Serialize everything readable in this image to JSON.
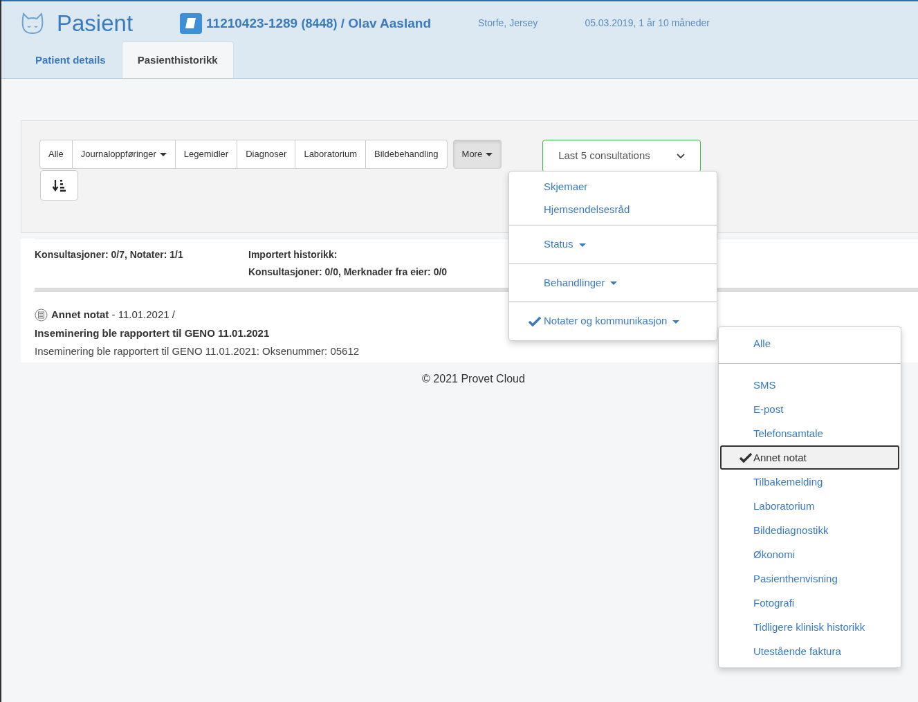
{
  "header": {
    "title": "Pasient",
    "record_number": "11210423-1289",
    "record_suffix": "(8448)",
    "separator": "/",
    "owner": "Olav Aasland",
    "location": "Storfe, Jersey",
    "birth_info": "05.03.2019, 1 år 10 måneder"
  },
  "tabs": [
    {
      "label": "Patient details",
      "selected": false
    },
    {
      "label": "Pasienthistorikk",
      "selected": true
    }
  ],
  "filters": [
    {
      "label": "Alle",
      "kind": "button"
    },
    {
      "label": "Journaloppføringer",
      "kind": "dropdown"
    },
    {
      "label": "Legemidler",
      "kind": "button"
    },
    {
      "label": "Diagnoser",
      "kind": "button"
    },
    {
      "label": "Laboratorium",
      "kind": "button"
    },
    {
      "label": "Bildebehandling",
      "kind": "button"
    }
  ],
  "more_button": {
    "label": "More",
    "expanded": true
  },
  "consultation_select": {
    "value": "Last 5 consultations"
  },
  "more_menu": {
    "sections": [
      [
        {
          "label": "Skjemaer",
          "kind": "link",
          "checked": false
        },
        {
          "label": "Hjemsendelsesråd",
          "kind": "link",
          "checked": false
        }
      ],
      [
        {
          "label": "Status",
          "kind": "submenu",
          "checked": false
        }
      ],
      [
        {
          "label": "Behandlinger",
          "kind": "submenu",
          "checked": false
        }
      ],
      [
        {
          "label": "Notater og kommunikasjon",
          "kind": "submenu",
          "checked": true
        }
      ]
    ]
  },
  "submenu": {
    "sections": [
      [
        {
          "label": "Alle",
          "selected": false
        }
      ],
      [
        {
          "label": "SMS",
          "selected": false
        },
        {
          "label": "E-post",
          "selected": false
        },
        {
          "label": "Telefonsamtale",
          "selected": false
        },
        {
          "label": "Annet notat",
          "selected": true
        },
        {
          "label": "Tilbakemelding",
          "selected": false
        },
        {
          "label": "Laboratorium",
          "selected": false
        },
        {
          "label": "Bildediagnostikk",
          "selected": false
        },
        {
          "label": "Økonomi",
          "selected": false
        },
        {
          "label": "Pasienthenvisning",
          "selected": false
        },
        {
          "label": "Fotografi",
          "selected": false
        },
        {
          "label": "Tidligere klinisk historikk",
          "selected": false
        },
        {
          "label": "Utestående faktura",
          "selected": false
        }
      ]
    ]
  },
  "summary": {
    "counts": "Konsultasjoner: 0/7, Notater: 1/1",
    "imported_title": "Importert historikk:",
    "imported_counts": "Konsultasjoner: 0/0, Merknader fra eier: 0/0"
  },
  "entries": [
    {
      "heading": "**Annet notat** - 11.01.2021 /",
      "title": "Inseminering ble rapportert til GENO 11.01.2021",
      "body": "Inseminering ble rapportert til GENO 11.01.2021: Oksenummer: 05612"
    }
  ],
  "footer": "© 2021 Provet Cloud"
}
